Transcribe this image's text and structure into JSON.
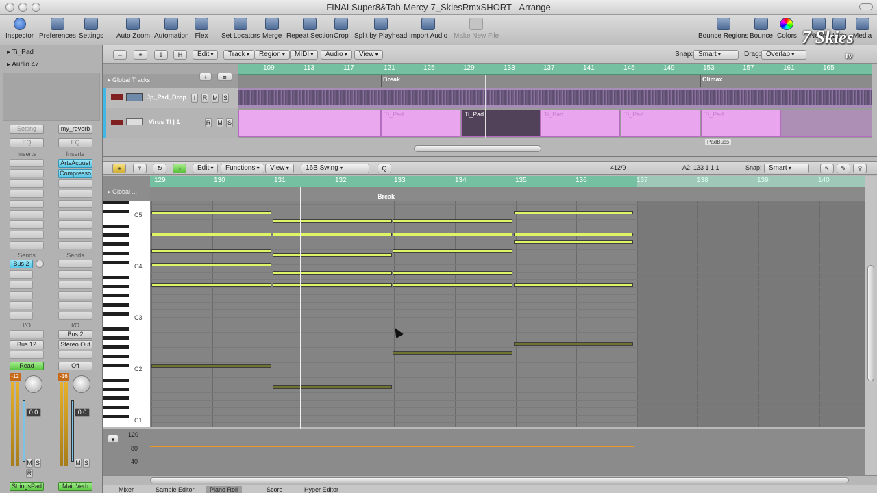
{
  "window": {
    "title": "FINALSuper8&Tab-Mercy-7_SkiesRmxSHORT - Arrange"
  },
  "toolbar": {
    "left": [
      "Inspector",
      "Preferences",
      "Settings"
    ],
    "center": [
      "Auto Zoom",
      "Automation",
      "Flex",
      "Set Locators",
      "Merge",
      "Repeat Section",
      "Crop",
      "Split by Playhead",
      "Import Audio",
      "Make New File"
    ],
    "right": [
      "Bounce Regions",
      "Bounce",
      "Colors",
      "Notes",
      "Lists",
      "Media"
    ]
  },
  "logo": {
    "text": "7 Skies",
    "sub": "tv"
  },
  "inspector": {
    "track_rows": [
      "Ti_Pad",
      "Audio 47"
    ],
    "strip1": {
      "setting": "Setting",
      "eq": "EQ",
      "inserts": "Inserts",
      "sends": "Sends",
      "send1": "Bus 2",
      "io": "I/O",
      "io_value": "Bus 12",
      "mode": "Read",
      "gain": "0.0",
      "meter": "-12",
      "m": "M",
      "s": "S",
      "r": "R",
      "name": "StringsPad"
    },
    "strip2": {
      "setting": "my_reverb",
      "eq": "EQ",
      "inserts": "Inserts",
      "insert1": "ArtsAcoust",
      "insert2": "Compresso",
      "sends": "Sends",
      "io": "I/O",
      "io_in": "Bus 2",
      "io_out": "Stereo Out",
      "mode": "Off",
      "gain": "0.0",
      "meter": "-16",
      "m": "M",
      "s": "S",
      "name": "MainVerb"
    }
  },
  "arrange": {
    "menus": [
      "Edit",
      "Track",
      "Region",
      "MIDI",
      "Audio",
      "View"
    ],
    "icon_buttons": [
      "H"
    ],
    "snap_label": "Snap:",
    "snap_value": "Smart",
    "drag_label": "Drag:",
    "drag_value": "Overlap",
    "ruler": [
      "109",
      "113",
      "117",
      "121",
      "125",
      "129",
      "133",
      "137",
      "141",
      "145",
      "149",
      "153",
      "157",
      "161",
      "165"
    ],
    "global_tracks": "Global Tracks",
    "markers": [
      "Break",
      "Climax"
    ],
    "tracks": [
      {
        "name": "Jp_Pad_Drop",
        "buttons": [
          "I",
          "R",
          "M",
          "S"
        ]
      },
      {
        "name": "Virus TI | 1",
        "buttons": [
          "R",
          "M",
          "S"
        ]
      }
    ],
    "regions": [
      "Ti_Pad",
      "Ti_Pad",
      "Ti_Pad",
      "Ti_Pad",
      "Ti_Pad"
    ],
    "extra_region": "PadBuss"
  },
  "piano_roll": {
    "menus": [
      "Edit",
      "Functions",
      "View"
    ],
    "quantize": "16B Swing",
    "quantize_btn": "Q",
    "position": "412/9",
    "note_info": "A2  133 1 1 1",
    "snap_label": "Snap:",
    "snap_value": "Smart",
    "ruler": [
      "129",
      "130",
      "131",
      "132",
      "133",
      "134",
      "135",
      "136",
      "137",
      "138",
      "139",
      "140"
    ],
    "global_label": "Global ...",
    "marker": "Break",
    "key_labels": [
      "C5",
      "C4",
      "C3",
      "C2",
      "C1"
    ],
    "velocity_scale": [
      "120",
      "80",
      "40"
    ],
    "notes_color": "#e0f565"
  },
  "tabs": [
    "Mixer",
    "Sample Editor",
    "Piano Roll",
    "Score",
    "Hyper Editor"
  ],
  "active_tab": "Piano Roll"
}
